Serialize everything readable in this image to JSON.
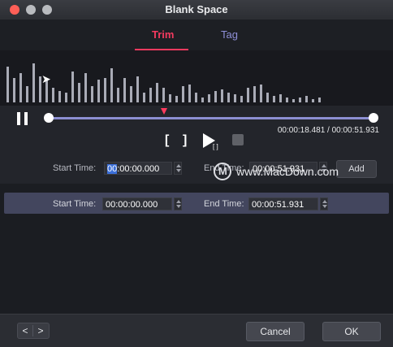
{
  "window": {
    "title": "Blank Space"
  },
  "tabs": [
    {
      "label": "Trim",
      "active": true
    },
    {
      "label": "Tag",
      "active": false
    }
  ],
  "colors": {
    "accent": "#f33a5f",
    "tab_inactive": "#8f8fd7",
    "waveform": "#a9abb6",
    "track": "#8c8fd2",
    "segment_row_bg": "#43465e"
  },
  "waveform": {
    "bars": [
      44,
      30,
      36,
      20,
      48,
      32,
      28,
      18,
      14,
      12,
      38,
      24,
      36,
      20,
      28,
      30,
      42,
      18,
      30,
      20,
      32,
      12,
      18,
      24,
      18,
      10,
      8,
      20,
      22,
      12,
      6,
      10,
      14,
      16,
      12,
      10,
      8,
      18,
      20,
      22,
      12,
      8,
      10,
      6,
      4,
      6,
      8,
      4,
      6
    ]
  },
  "playback": {
    "state": "paused",
    "progress": 0.3554,
    "current_time": "00:00:18.481",
    "separator": "/",
    "total_time": "00:00:51.931",
    "time_readout": "00:00:18.481 / 00:00:51.931",
    "play_sub_label": "[ ]"
  },
  "controls": {
    "mark_in_icon": "bracket-left-icon",
    "mark_out_icon": "bracket-right-icon",
    "play_icon": "play-icon",
    "stop_icon": "stop-icon",
    "pause_icon": "pause-icon",
    "mark_in_glyph": "[",
    "mark_out_glyph": "]"
  },
  "edit_row": {
    "start_label": "Start Time:",
    "start_value_selected": "00",
    "start_value_rest": ":00:00.000",
    "end_label": "End Time:",
    "end_value": "00:00:51.931",
    "add_label": "Add"
  },
  "segments": [
    {
      "start_label": "Start Time:",
      "start_value": "00:00:00.000",
      "end_label": "End Time:",
      "end_value": "00:00:51.931"
    }
  ],
  "footer": {
    "prev_glyph": "<",
    "next_glyph": ">",
    "cancel_label": "Cancel",
    "ok_label": "OK"
  },
  "watermark": {
    "logo_letter": "M",
    "text": "www.MacDown.com"
  }
}
